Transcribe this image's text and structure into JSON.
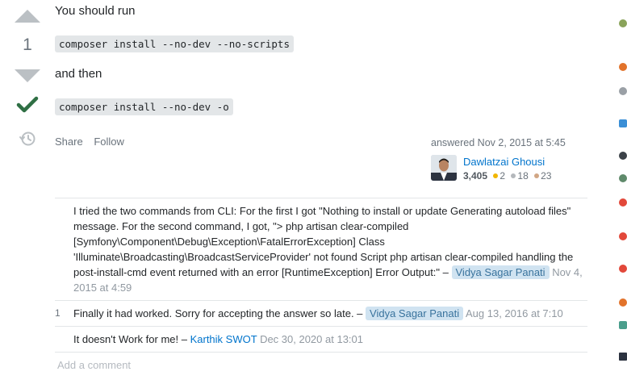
{
  "vote": {
    "score": "1"
  },
  "answer": {
    "intro": "You should run",
    "code1": "composer install --no-dev --no-scripts",
    "then": "and then",
    "code2": "composer install --no-dev -o"
  },
  "menu": {
    "share": "Share",
    "follow": "Follow"
  },
  "signature": {
    "answered": "answered Nov 2, 2015 at 5:45",
    "user": "Dawlatzai Ghousi",
    "reputation": "3,405",
    "gold": "2",
    "silver": "18",
    "bronze": "23"
  },
  "comments": [
    {
      "score": "",
      "text": "I tried the two commands from CLI: For the first I got \"Nothing to install or update Generating autoload files\" message. For the second command, I got, \"> php artisan clear-compiled [Symfony\\Component\\Debug\\Exception\\FatalErrorException] Class 'Illuminate\\Broadcasting\\BroadcastServiceProvider' not found Script php artisan clear-compiled handling the post-install-cmd event returned with an error [RuntimeException] Error Output:\"",
      "sep": " – ",
      "user": "Vidya Sagar Panati",
      "date": "Nov 4, 2015 at 4:59"
    },
    {
      "score": "1",
      "text": "Finally it had worked. Sorry for accepting the answer so late.",
      "sep": " – ",
      "user": "Vidya Sagar Panati",
      "date": "Aug 13, 2016 at 7:10"
    },
    {
      "score": "",
      "text": "It doesn't Work for me!",
      "sep": " – ",
      "user": "Karthik SWOT",
      "date": "Dec 30, 2020 at 13:01"
    }
  ],
  "add_comment": "Add a comment",
  "colors": {
    "gold": "#f1b600",
    "silver": "#b4b8bc",
    "bronze": "#d1a684",
    "accepted": "#2f6f44",
    "link": "#0074cc"
  }
}
